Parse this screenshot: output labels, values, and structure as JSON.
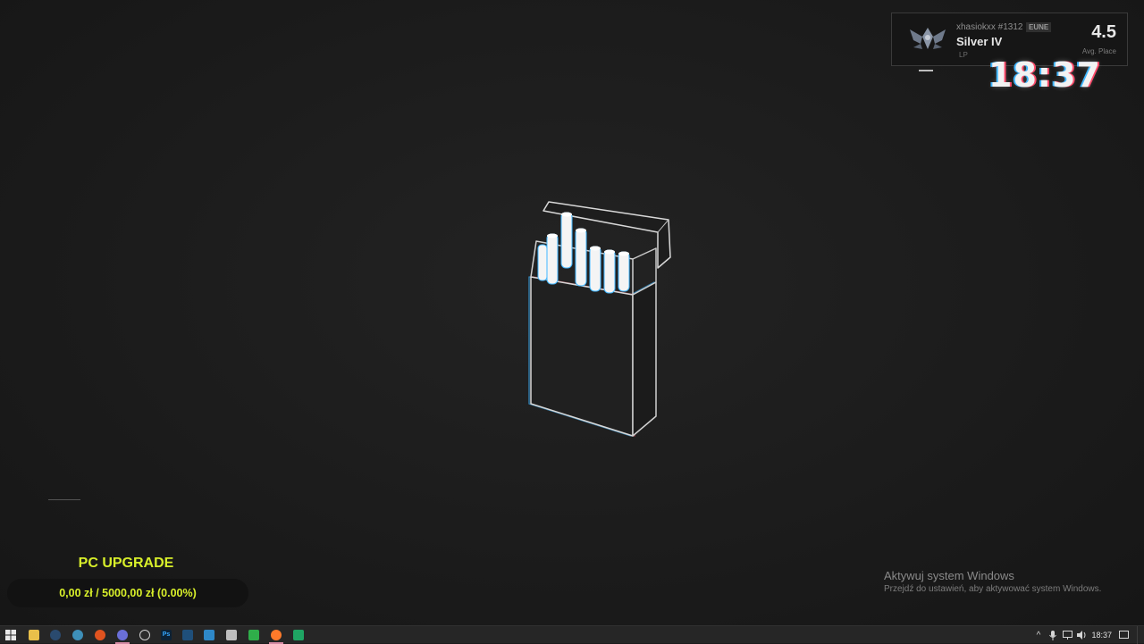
{
  "rank_widget": {
    "summoner_name": "xhasiokxx #1312",
    "region": "EUNE",
    "rank": "Silver IV",
    "lp_label": "LP",
    "avg_place_value": "4.5",
    "avg_place_label": "Avg. Place",
    "emblem_icon": "silver-wings-emblem-icon"
  },
  "clock": {
    "time": "18:37"
  },
  "upgrade": {
    "title": "PC UPGRADE",
    "progress_text": "0,00 zł / 5000,00 zł (0.00%)",
    "progress_fraction": 0.0,
    "accent_color": "#d8ef2a"
  },
  "activation": {
    "title": "Aktywuj system Windows",
    "subtitle": "Przejdź do ustawień, aby aktywować system Windows."
  },
  "taskbar": {
    "items": [
      {
        "name": "start-button",
        "icon": "windows-start-icon"
      },
      {
        "name": "file-explorer",
        "icon": "folder-icon"
      },
      {
        "name": "steam",
        "icon": "steam-icon"
      },
      {
        "name": "browser-globe",
        "icon": "globe-icon"
      },
      {
        "name": "brave",
        "icon": "brave-icon"
      },
      {
        "name": "discord",
        "icon": "discord-icon",
        "active": true
      },
      {
        "name": "obs",
        "icon": "obs-icon"
      },
      {
        "name": "photoshop",
        "icon": "photoshop-icon"
      },
      {
        "name": "ps-remote",
        "icon": "terminal-icon"
      },
      {
        "name": "app-blue",
        "icon": "app-window-icon"
      },
      {
        "name": "app-gray",
        "icon": "cube-icon"
      },
      {
        "name": "app-green",
        "icon": "leaf-icon"
      },
      {
        "name": "firefox",
        "icon": "firefox-icon",
        "active": true
      },
      {
        "name": "spotify",
        "icon": "sheets-icon"
      }
    ],
    "tray": {
      "chevron": "^",
      "clock": "18:37"
    }
  }
}
